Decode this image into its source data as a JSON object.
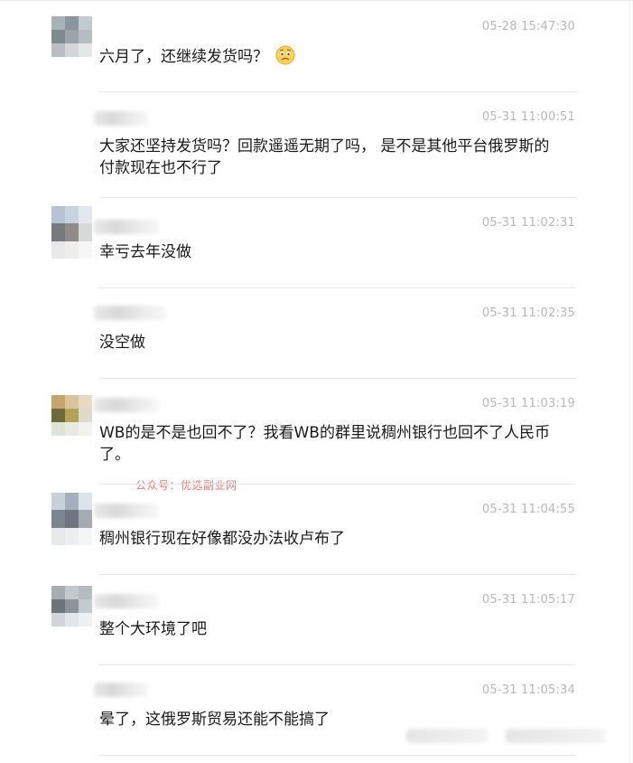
{
  "watermark": "公众号：优选副业网",
  "messages": [
    {
      "time": "05-28 15:47:30",
      "text": "六月了，还继续发货吗？",
      "emoji": "worried-face-icon"
    },
    {
      "time": "05-31 11:00:51",
      "text": "大家还坚持发货吗？回款遥遥无期了吗， 是不是其他平台俄罗斯的付款现在也不行了"
    },
    {
      "time": "05-31 11:02:31",
      "text": "幸亏去年没做"
    },
    {
      "time": "05-31 11:02:35",
      "text": "没空做"
    },
    {
      "time": "05-31 11:03:19",
      "text": "WB的是不是也回不了？我看WB的群里说稠州银行也回不了人民币了。"
    },
    {
      "time": "05-31 11:04:55",
      "text": "稠州银行现在好像都没办法收卢布了"
    },
    {
      "time": "05-31 11:05:17",
      "text": "整个大环境了吧"
    },
    {
      "time": "05-31 11:05:34",
      "text": "晕了，这俄罗斯贸易还能不能搞了"
    }
  ]
}
